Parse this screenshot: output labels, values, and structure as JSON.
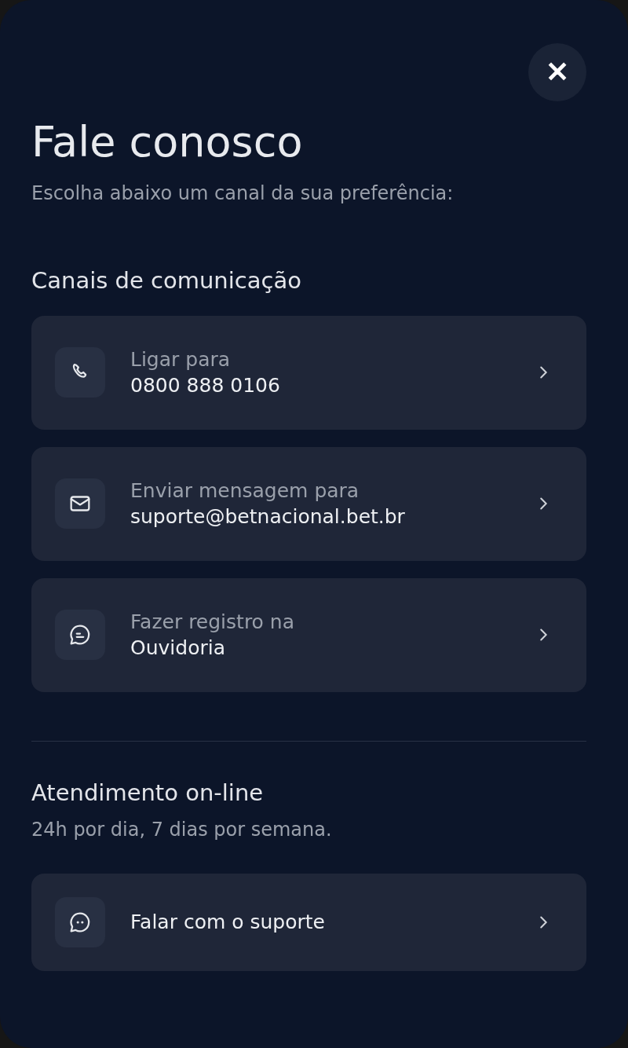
{
  "close_button": "✕",
  "title": "Fale conosco",
  "subtitle": "Escolha abaixo um canal da sua preferência:",
  "sections": [
    {
      "heading": "Canais de comunicação",
      "cards": [
        {
          "kind": "contact",
          "label": "Ligar para",
          "value": "0800 888 0106"
        },
        {
          "kind": "contact",
          "label": "Enviar mensagem para",
          "value": "suporte@betnacional.bet.br"
        },
        {
          "kind": "contact",
          "label": "Fazer registro na",
          "value": "Ouvidoria"
        }
      ]
    },
    {
      "heading": "Atendimento on-line",
      "note": "24h por dia, 7 dias por semana.",
      "cards": [
        {
          "kind": "action",
          "value": "Falar com o suporte"
        }
      ]
    }
  ]
}
